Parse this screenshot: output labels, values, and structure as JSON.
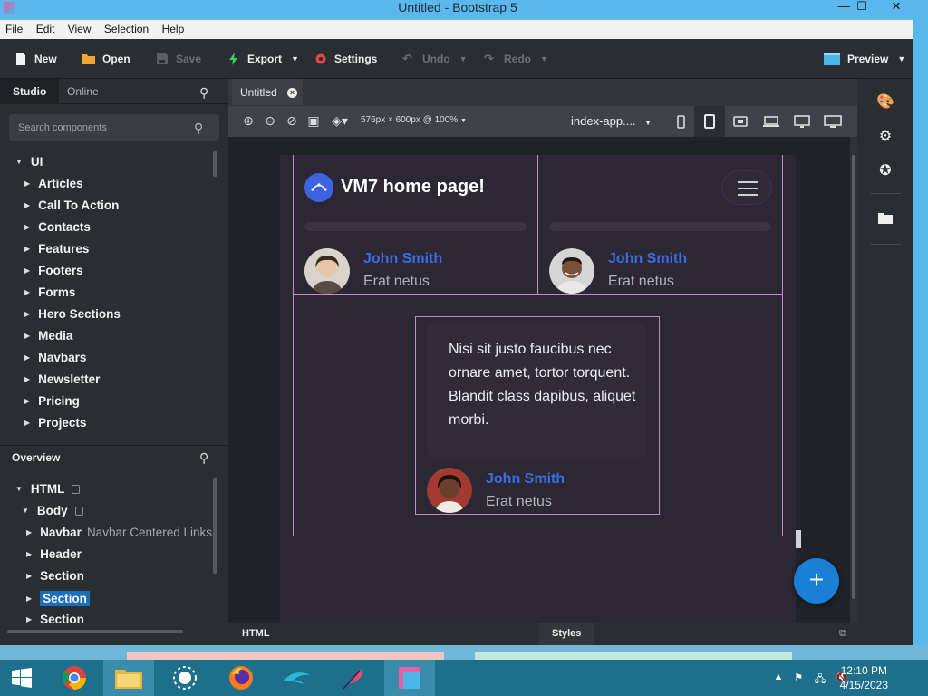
{
  "window": {
    "title": "Untitled - Bootstrap 5",
    "minimize": "—",
    "maximize": "☐",
    "close": "✕"
  },
  "menu": [
    "File",
    "Edit",
    "View",
    "Selection",
    "Help"
  ],
  "toolbar": {
    "new": "New",
    "open": "Open",
    "save": "Save",
    "export": "Export",
    "settings": "Settings",
    "undo": "Undo",
    "redo": "Redo",
    "preview": "Preview"
  },
  "sidebar": {
    "tab_studio": "Studio",
    "tab_online": "Online",
    "search_placeholder": "Search components",
    "root": "UI",
    "categories": [
      "Articles",
      "Call To Action",
      "Contacts",
      "Features",
      "Footers",
      "Forms",
      "Hero Sections",
      "Media",
      "Navbars",
      "Newsletter",
      "Pricing",
      "Projects"
    ]
  },
  "overview": {
    "title": "Overview",
    "html": "HTML",
    "body": "Body",
    "nodes": [
      {
        "label": "Navbar",
        "sub": "Navbar Centered Links",
        "selected": false
      },
      {
        "label": "Header",
        "sub": "",
        "selected": false
      },
      {
        "label": "Section",
        "sub": "",
        "selected": false
      },
      {
        "label": "Section",
        "sub": "",
        "selected": true
      },
      {
        "label": "Section",
        "sub": "",
        "selected": false
      }
    ]
  },
  "editor": {
    "tab": "Untitled",
    "canvas_size": "576px × 600px @ 100%",
    "page_file": "index-app....",
    "bottom_left": "HTML",
    "bottom_right": "Styles"
  },
  "preview": {
    "brand": "VM7 home page!",
    "person_left": {
      "name": "John Smith",
      "sub": "Erat netus"
    },
    "person_right": {
      "name": "John Smith",
      "sub": "Erat netus"
    },
    "quote": "Nisi sit justo faucibus nec ornare amet, tortor torquent. Blandit class dapibus, aliquet morbi.",
    "person_center": {
      "name": "John Smith",
      "sub": "Erat netus"
    }
  },
  "taskbar": {
    "time": "12:10 PM",
    "date": "4/15/2023"
  },
  "colors": {
    "accent": "#3c6de0",
    "fab": "#1c7fd6",
    "selection": "#1a6fbd",
    "page_bg": "#2b2735",
    "border": "#c78ac0"
  }
}
